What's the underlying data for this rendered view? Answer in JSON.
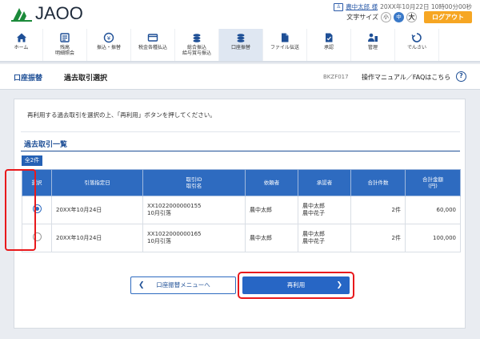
{
  "header": {
    "logo_text": "JAOO",
    "user_name": "農中太郎 様",
    "datetime": "20XX年10月22日 10時00分00秒",
    "font_size_label": "文字サイズ",
    "font_sizes": [
      "小",
      "中",
      "大"
    ],
    "active_font_size": "中",
    "logout_label": "ログアウト"
  },
  "nav": {
    "items": [
      {
        "label": "ホーム",
        "icon": "home-icon"
      },
      {
        "label": "残高\n明細照会",
        "icon": "balance-icon"
      },
      {
        "label": "振込・振替",
        "icon": "transfer-icon"
      },
      {
        "label": "税金各種払込",
        "icon": "tax-icon"
      },
      {
        "label": "総合振込\n給与賞与振込",
        "icon": "bulk-transfer-icon"
      },
      {
        "label": "口座振替",
        "icon": "account-transfer-icon"
      },
      {
        "label": "ファイル伝送",
        "icon": "file-transfer-icon"
      },
      {
        "label": "承認",
        "icon": "approval-icon"
      },
      {
        "label": "管理",
        "icon": "admin-icon"
      },
      {
        "label": "でんさい",
        "icon": "densai-icon"
      }
    ],
    "active": "口座振替"
  },
  "page": {
    "category": "口座振替",
    "title": "過去取引選択",
    "screen_code": "BKZF017",
    "help_label": "操作マニュアル／FAQはこちら"
  },
  "content": {
    "instruction": "再利用する過去取引を選択の上、「再利用」ボタンを押してください。",
    "list_title": "過去取引一覧",
    "count_badge": "全2件",
    "columns": [
      "選択",
      "引落指定日",
      "取引ID\n取引名",
      "依頼者",
      "承認者",
      "合計件数",
      "合計金額\n(円)"
    ],
    "rows": [
      {
        "selected": true,
        "date": "20XX年10月24日",
        "transaction": "XX1022000000155\n10月引落",
        "requester": "農中太郎",
        "approver": "農中太郎\n農中花子",
        "count": "2件",
        "amount": "60,000"
      },
      {
        "selected": false,
        "date": "20XX年10月24日",
        "transaction": "XX1022000000165\n10月引落",
        "requester": "農中太郎",
        "approver": "農中太郎\n農中花子",
        "count": "2件",
        "amount": "100,000"
      }
    ]
  },
  "buttons": {
    "back_label": "口座振替メニューへ",
    "reuse_label": "再利用"
  },
  "colors": {
    "primary": "#2e6bc0",
    "highlight": "#e8191c",
    "logout": "#f6a623"
  }
}
